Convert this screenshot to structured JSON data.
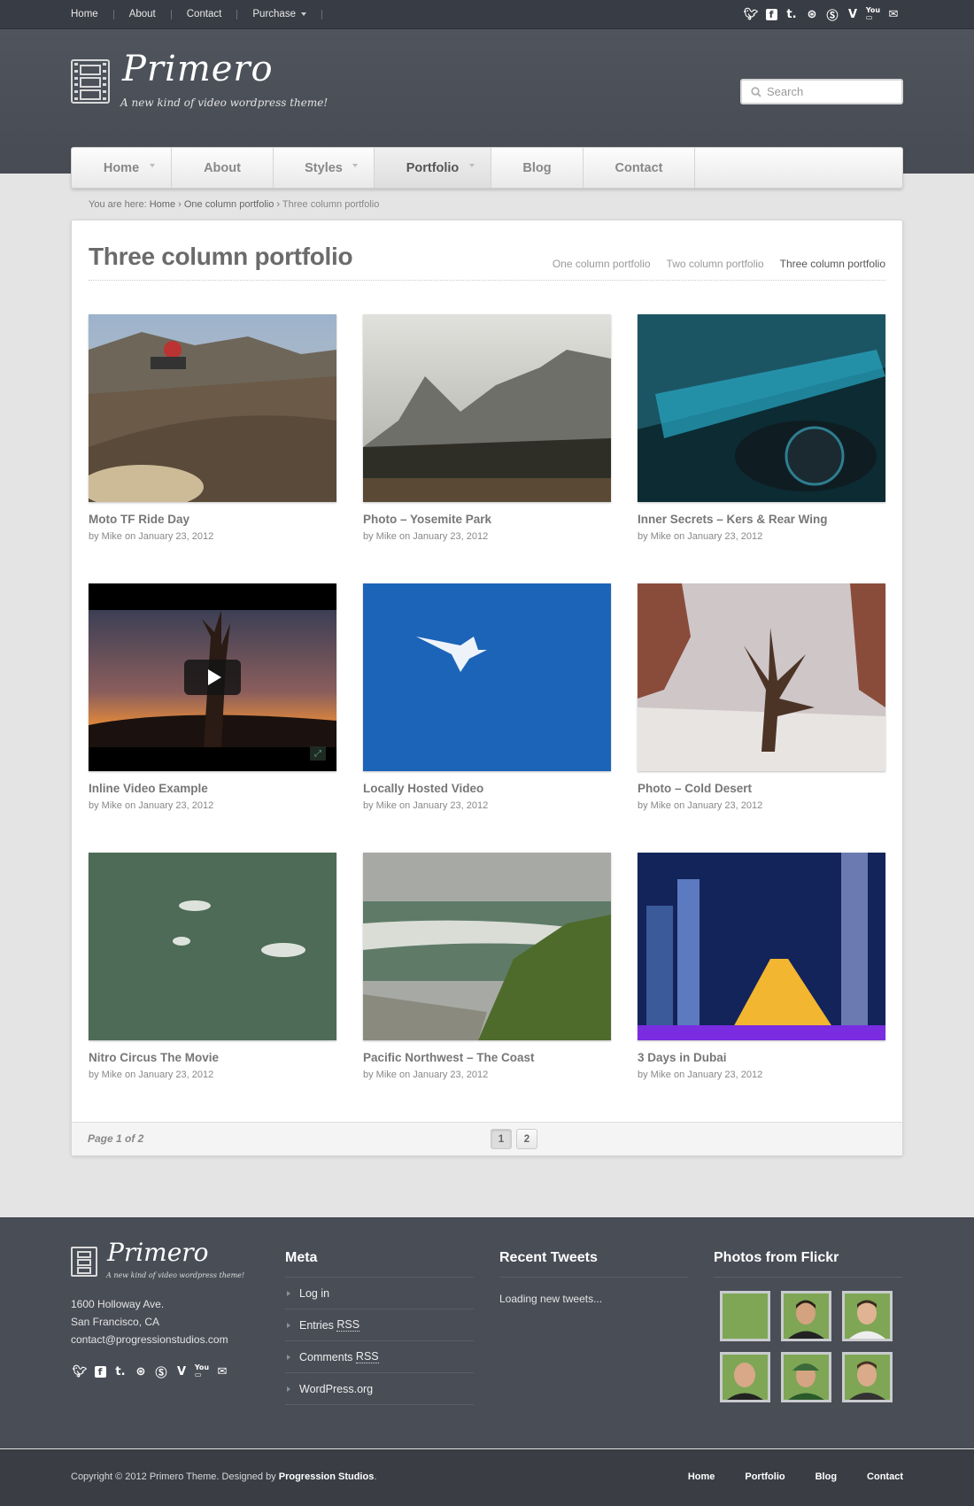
{
  "topnav": {
    "items": [
      "Home",
      "About",
      "Contact",
      "Purchase"
    ]
  },
  "social_icons": [
    "twitter-icon",
    "facebook-icon",
    "tumblr-icon",
    "dribbble-icon",
    "skype-icon",
    "vimeo-icon",
    "youtube-icon",
    "email-icon"
  ],
  "brand": {
    "name": "Primero",
    "tagline": "A new kind of video wordpress theme!"
  },
  "search": {
    "placeholder": "Search"
  },
  "mainnav": {
    "items": [
      "Home",
      "About",
      "Styles",
      "Portfolio",
      "Blog",
      "Contact"
    ],
    "active": "Portfolio"
  },
  "breadcrumb": {
    "prefix": "You are here:",
    "home": "Home",
    "parent": "One column portfolio",
    "current": "Three column portfolio"
  },
  "page": {
    "title": "Three column portfolio",
    "tabs": [
      "One column portfolio",
      "Two column portfolio",
      "Three column portfolio"
    ],
    "current_tab": "Three column portfolio"
  },
  "portfolio": [
    {
      "title": "Moto TF Ride Day",
      "meta": "by Mike on January 23, 2012"
    },
    {
      "title": "Photo – Yosemite Park",
      "meta": "by Mike on January 23, 2012"
    },
    {
      "title": "Inner Secrets – Kers & Rear Wing",
      "meta": "by Mike on January 23, 2012"
    },
    {
      "title": "Inline Video Example",
      "meta": "by Mike on January 23, 2012"
    },
    {
      "title": "Locally Hosted Video",
      "meta": "by Mike on January 23, 2012"
    },
    {
      "title": "Photo – Cold Desert",
      "meta": "by Mike on January 23, 2012"
    },
    {
      "title": "Nitro Circus The Movie",
      "meta": "by Mike on January 23, 2012"
    },
    {
      "title": "Pacific Northwest – The Coast",
      "meta": "by Mike on January 23, 2012"
    },
    {
      "title": "3 Days in Dubai",
      "meta": "by Mike on January 23, 2012"
    }
  ],
  "pagination": {
    "label": "Page 1 of 2",
    "pages": [
      "1",
      "2"
    ],
    "current": "1"
  },
  "footer": {
    "brand": "Primero",
    "tagline": "A new kind of video wordpress theme!",
    "address": [
      "1600 Holloway Ave.",
      "San Francisco, CA",
      "contact@progressionstudios.com"
    ],
    "meta_heading": "Meta",
    "meta_links": [
      "Log in",
      "Entries",
      "Comments",
      "WordPress.org"
    ],
    "rss": "RSS",
    "tweets_heading": "Recent Tweets",
    "tweets_text": "Loading new tweets...",
    "flickr_heading": "Photos from Flickr"
  },
  "bottom": {
    "copyright": "Copyright © 2012 Primero Theme. Designed by",
    "designer": "Progression Studios",
    "nav": [
      "Home",
      "Portfolio",
      "Blog",
      "Contact"
    ]
  }
}
